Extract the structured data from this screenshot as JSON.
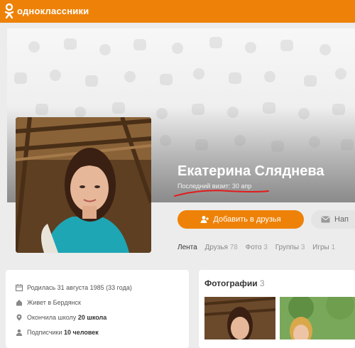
{
  "header": {
    "brand": "одноклассники",
    "brand_color": "#ee8208",
    "logo_icon": "ok-logo-icon"
  },
  "profile": {
    "name": "Екатерина Сляднева",
    "last_visit": "Последний визит: 30 апр",
    "add_friend_label": "Добавить в друзья",
    "add_friend_icon": "add-user-icon",
    "message_label": "Нап",
    "message_icon": "message-icon"
  },
  "tabs": [
    {
      "label": "Лента",
      "count": ""
    },
    {
      "label": "Друзья",
      "count": "78"
    },
    {
      "label": "Фото",
      "count": "3"
    },
    {
      "label": "Группы",
      "count": "3"
    },
    {
      "label": "Игры",
      "count": "1"
    }
  ],
  "info": {
    "born": "Родилась 31 августа 1985 (33 года)",
    "lives_prefix": "Живет в ",
    "lives_city": "Бердянск",
    "school_prefix": "Окончила школу ",
    "school_name": "20 школа",
    "followers_prefix": "Подписчики ",
    "followers_count": "10 человек"
  },
  "photos": {
    "title": "Фотографии",
    "count": "3"
  }
}
